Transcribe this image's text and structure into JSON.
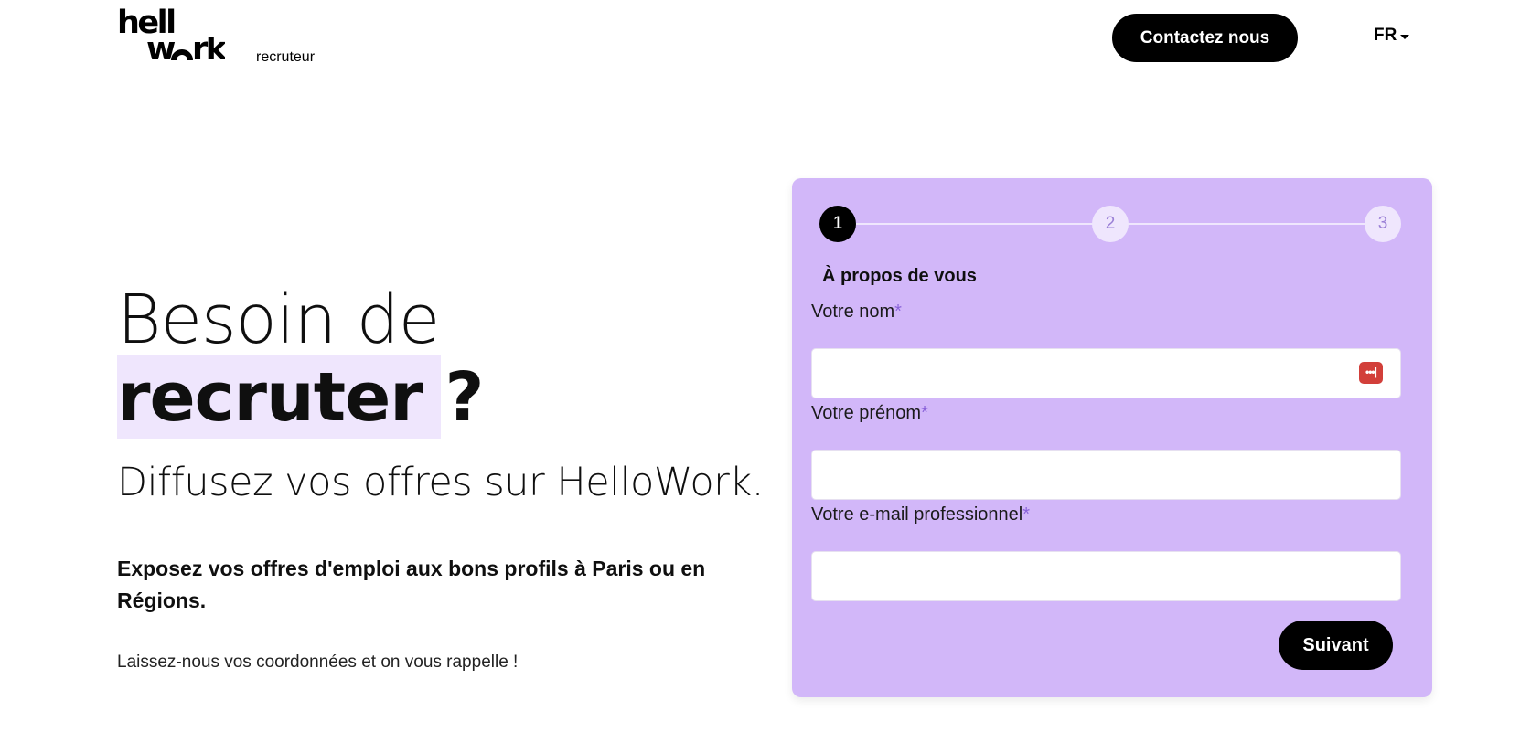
{
  "header": {
    "logo_top": "hell",
    "logo_bottom": "wrk",
    "logo_sub": "recruteur",
    "contact_label": "Contactez nous",
    "lang": "FR"
  },
  "hero": {
    "line1": "Besoin de",
    "line2": "recruter ?",
    "subtitle": "Diffusez vos offres sur HelloWork.",
    "expose": "Exposez vos offres d'emploi aux bons profils à Paris ou en Régions.",
    "leave": "Laissez-nous vos coordonnées et on vous rappelle !"
  },
  "form": {
    "steps": [
      "1",
      "2",
      "3"
    ],
    "active_step": 1,
    "step_title": "À propos de vous",
    "fields": [
      {
        "label": "Votre nom",
        "required": "*",
        "value": ""
      },
      {
        "label": "Votre prénom",
        "required": "*",
        "value": ""
      },
      {
        "label": "Votre e-mail professionnel",
        "required": "*",
        "value": ""
      }
    ],
    "next_label": "Suivant",
    "password_icon_text": "•••|"
  },
  "colors": {
    "card_bg": "#d2b7f9",
    "highlight": "#efe6fd",
    "required_star": "#8a63d9",
    "button_bg": "#000000"
  }
}
